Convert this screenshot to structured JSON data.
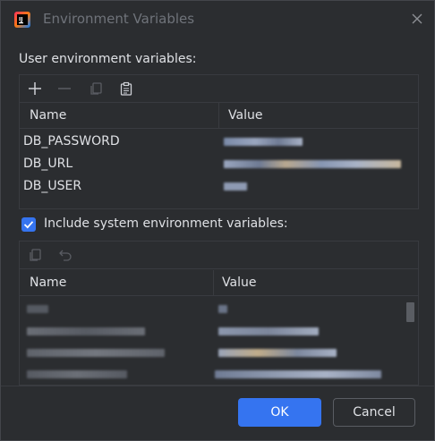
{
  "window": {
    "title": "Environment Variables"
  },
  "user_section": {
    "label": "User environment variables:",
    "columns": {
      "name": "Name",
      "value": "Value"
    },
    "rows": [
      {
        "name": "DB_PASSWORD"
      },
      {
        "name": "DB_URL"
      },
      {
        "name": "DB_USER"
      }
    ]
  },
  "system_section": {
    "checkbox_label": "Include system environment variables:",
    "checked": true,
    "columns": {
      "name": "Name",
      "value": "Value"
    }
  },
  "buttons": {
    "ok": "OK",
    "cancel": "Cancel"
  },
  "colors": {
    "background": "#2b2d30",
    "accent": "#3574f0",
    "text": "#dfe1e5",
    "muted": "#6f737a"
  },
  "icons": {
    "app": "intellij-app-icon",
    "close": "close-icon",
    "add": "plus-icon",
    "remove": "minus-icon",
    "copy": "copy-icon",
    "paste": "paste-icon",
    "undo": "undo-icon"
  }
}
